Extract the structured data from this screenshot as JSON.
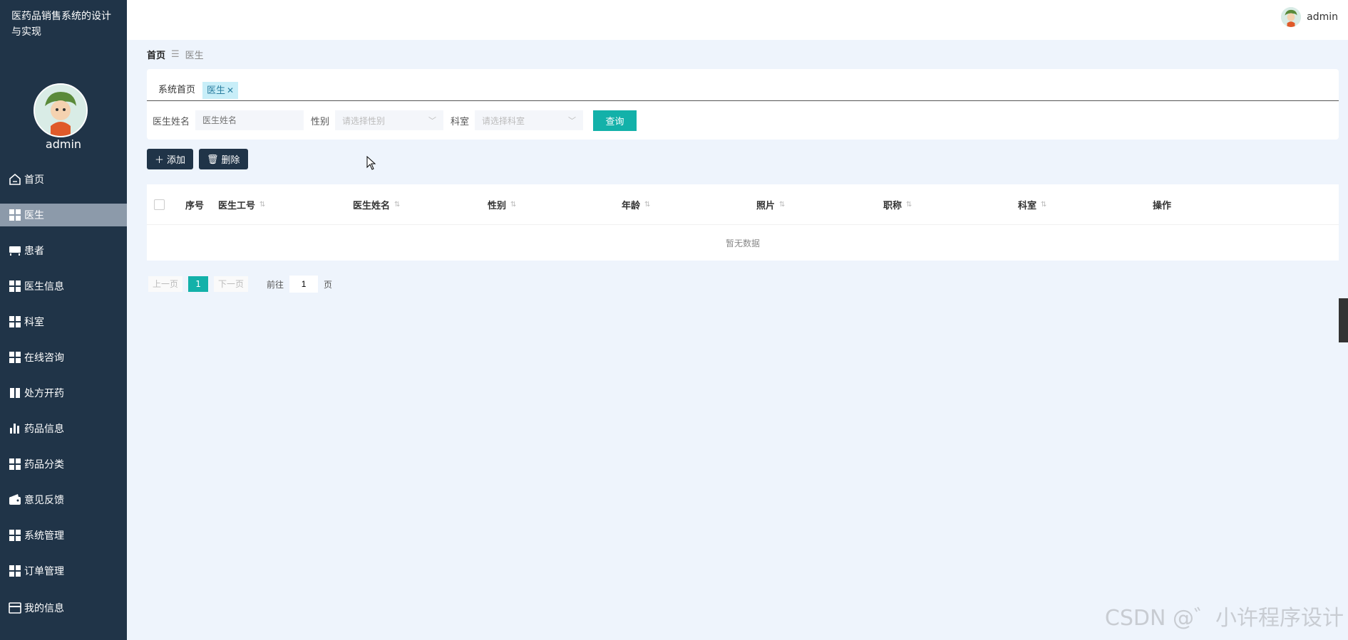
{
  "sidebar": {
    "app_title": "医药品销售系统的设计与实现",
    "username": "admin",
    "items": [
      {
        "label": "首页",
        "icon": "home-icon"
      },
      {
        "label": "医生",
        "icon": "grid-icon",
        "active": true
      },
      {
        "label": "患者",
        "icon": "bed-icon"
      },
      {
        "label": "医生信息",
        "icon": "grid-icon"
      },
      {
        "label": "科室",
        "icon": "grid-icon"
      },
      {
        "label": "在线咨询",
        "icon": "grid-icon"
      },
      {
        "label": "处方开药",
        "icon": "book-icon"
      },
      {
        "label": "药品信息",
        "icon": "bar-chart-icon"
      },
      {
        "label": "药品分类",
        "icon": "grid-icon"
      },
      {
        "label": "意见反馈",
        "icon": "wallet-icon"
      },
      {
        "label": "系统管理",
        "icon": "grid-icon"
      },
      {
        "label": "订单管理",
        "icon": "grid-icon"
      },
      {
        "label": "我的信息",
        "icon": "card-icon"
      }
    ]
  },
  "topbar": {
    "username": "admin"
  },
  "breadcrumb": {
    "home": "首页",
    "separator": "☰",
    "current": "医生"
  },
  "tabs": [
    {
      "label": "系统首页",
      "active": false
    },
    {
      "label": "医生",
      "active": true
    }
  ],
  "search": {
    "name_label": "医生姓名",
    "name_placeholder": "医生姓名",
    "gender_label": "性别",
    "gender_placeholder": "请选择性别",
    "dept_label": "科室",
    "dept_placeholder": "请选择科室",
    "query_button": "查询"
  },
  "actions": {
    "add_label": "添加",
    "delete_label": "删除"
  },
  "table": {
    "columns": [
      "序号",
      "医生工号",
      "医生姓名",
      "性别",
      "年龄",
      "照片",
      "职称",
      "科室",
      "操作"
    ],
    "empty_text": "暂无数据"
  },
  "pagination": {
    "prev": "上一页",
    "current_page": "1",
    "next": "下一页",
    "goto_label": "前往",
    "goto_value": "1",
    "goto_unit": "页"
  },
  "watermark": "CSDN @゛小许程序设计",
  "colors": {
    "sidebar_bg": "#203448",
    "accent": "#13b1a9",
    "page_bg": "#eef4fc"
  }
}
